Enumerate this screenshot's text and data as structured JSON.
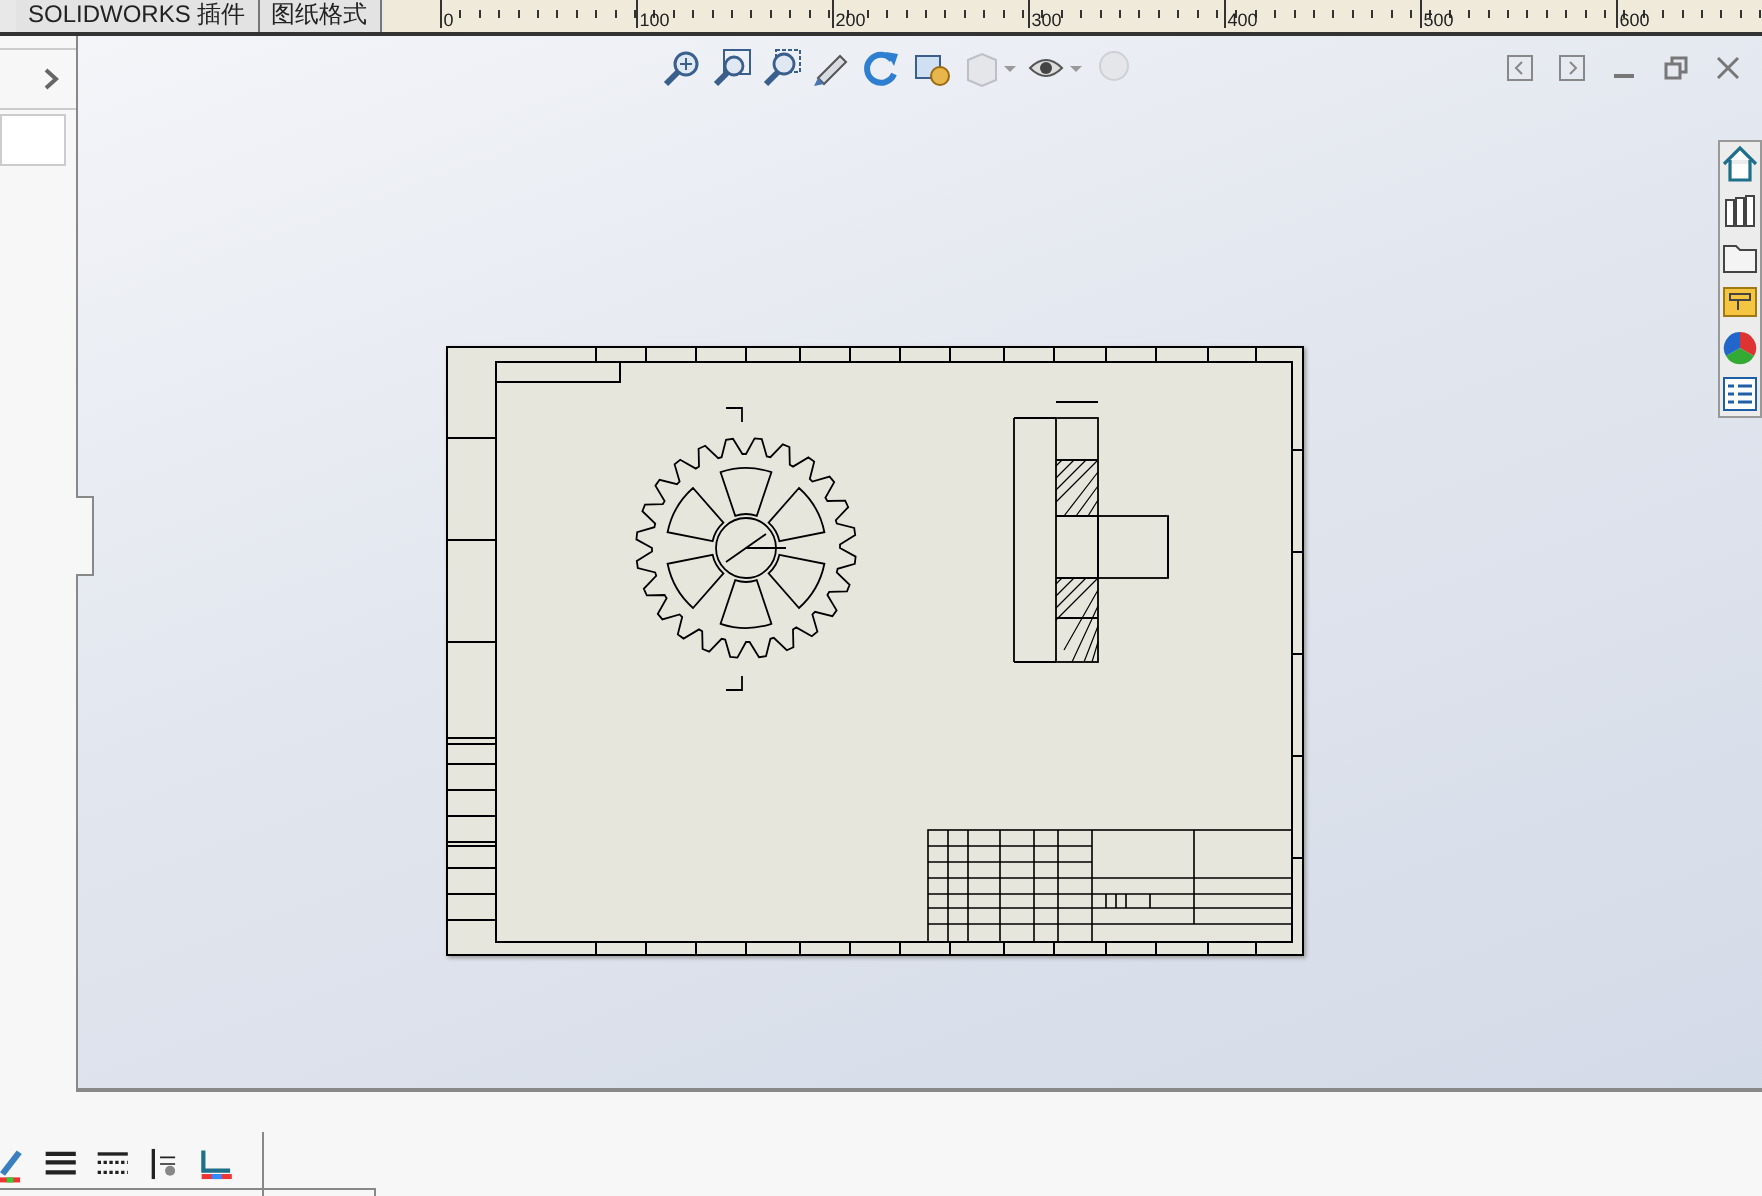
{
  "tabs": [
    {
      "label": "SOLIDWORKS 插件"
    },
    {
      "label": "图纸格式"
    }
  ],
  "ruler": {
    "labels": [
      "0",
      "100",
      "200",
      "300",
      "400",
      "500",
      "600"
    ]
  }
}
